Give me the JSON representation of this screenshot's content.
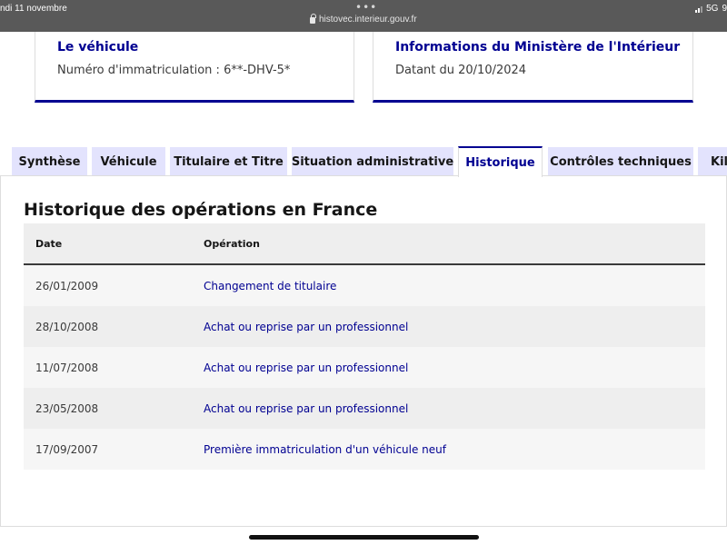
{
  "status_bar": {
    "date": "ndi 11 novembre",
    "dots": "•••",
    "url": "histovec.interieur.gouv.fr",
    "network": "5G",
    "extra": "9"
  },
  "cards": [
    {
      "title": "Le véhicule",
      "text": "Numéro d'immatriculation : 6**-DHV-5*"
    },
    {
      "title": "Informations du Ministère de l'Intérieur",
      "text": "Datant du 20/10/2024"
    }
  ],
  "tabs": [
    {
      "label": "Synthèse",
      "active": false
    },
    {
      "label": "Véhicule",
      "active": false
    },
    {
      "label": "Titulaire et Titre",
      "active": false
    },
    {
      "label": "Situation administrative",
      "active": false
    },
    {
      "label": "Historique",
      "active": true
    },
    {
      "label": "Contrôles techniques",
      "active": false
    },
    {
      "label": "Kilo",
      "active": false
    }
  ],
  "section": {
    "title": "Historique des opérations en France"
  },
  "table": {
    "headers": [
      "Date",
      "Opération"
    ],
    "rows": [
      {
        "date": "26/01/2009",
        "operation": "Changement de titulaire"
      },
      {
        "date": "28/10/2008",
        "operation": "Achat ou reprise par un professionnel"
      },
      {
        "date": "11/07/2008",
        "operation": "Achat ou reprise par un professionnel"
      },
      {
        "date": "23/05/2008",
        "operation": "Achat ou reprise par un professionnel"
      },
      {
        "date": "17/09/2007",
        "operation": "Première immatriculation d'un véhicule neuf"
      }
    ]
  },
  "colors": {
    "accent": "#000091",
    "tab_bg": "#e3e3fd",
    "topbar": "#595959"
  }
}
